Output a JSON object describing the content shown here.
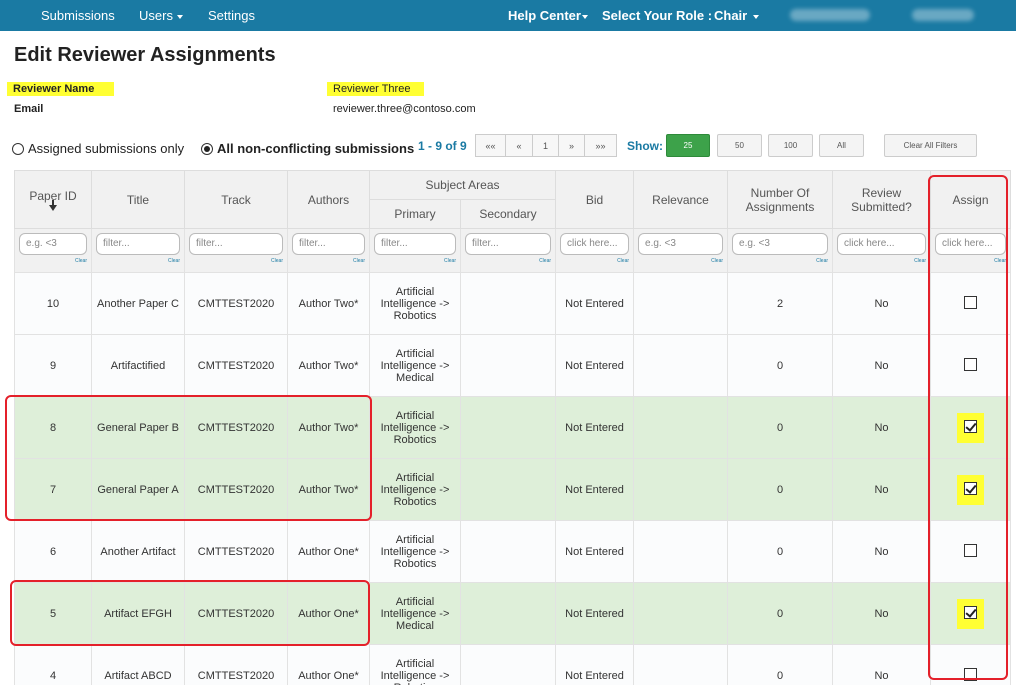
{
  "navbar": {
    "submissions": "Submissions",
    "users": "Users",
    "settings": "Settings",
    "help_center": "Help Center",
    "select_role_label": "Select Your Role :",
    "role": "Chair"
  },
  "page_title": "Edit Reviewer Assignments",
  "reviewer": {
    "name_label": "Reviewer Name",
    "name_value": "Reviewer Three",
    "email_label": "Email",
    "email_value": "reviewer.three@contoso.com"
  },
  "filter_options": {
    "assigned_only": "Assigned submissions only",
    "all_nonconflicting": "All non-conflicting submissions",
    "selected": "all_nonconflicting"
  },
  "pagination": {
    "summary": "1 - 9 of 9",
    "first": "««",
    "prev": "«",
    "current": "1",
    "next": "»",
    "last": "»»"
  },
  "show": {
    "label": "Show:",
    "options": [
      "25",
      "50",
      "100",
      "All"
    ],
    "selected": "25",
    "clear_filters": "Clear All Filters"
  },
  "table": {
    "headers": {
      "paper_id": "Paper ID",
      "title": "Title",
      "track": "Track",
      "authors": "Authors",
      "subject_areas": "Subject Areas",
      "primary": "Primary",
      "secondary": "Secondary",
      "bid": "Bid",
      "relevance": "Relevance",
      "num_assignments": "Number Of Assignments",
      "review_submitted": "Review Submitted?",
      "assign": "Assign"
    },
    "filters": {
      "paper_id": "e.g. <3",
      "title": "filter...",
      "track": "filter...",
      "authors": "filter...",
      "primary": "filter...",
      "secondary": "filter...",
      "bid": "click here...",
      "relevance": "e.g. <3",
      "num_assignments": "e.g. <3",
      "review_submitted": "click here...",
      "assign": "click here...",
      "clear": "Clear"
    },
    "rows": [
      {
        "id": "10",
        "title": "Another Paper C",
        "track": "CMTTEST2020",
        "authors": "Author Two*",
        "primary": "Artificial Intelligence -> Robotics",
        "secondary": "",
        "bid": "Not Entered",
        "relevance": "",
        "assignments": "2",
        "review_submitted": "No",
        "assigned": false
      },
      {
        "id": "9",
        "title": "Artifactified",
        "track": "CMTTEST2020",
        "authors": "Author Two*",
        "primary": "Artificial Intelligence -> Medical",
        "secondary": "",
        "bid": "Not Entered",
        "relevance": "",
        "assignments": "0",
        "review_submitted": "No",
        "assigned": false
      },
      {
        "id": "8",
        "title": "General Paper B",
        "track": "CMTTEST2020",
        "authors": "Author Two*",
        "primary": "Artificial Intelligence -> Robotics",
        "secondary": "",
        "bid": "Not Entered",
        "relevance": "",
        "assignments": "0",
        "review_submitted": "No",
        "assigned": true
      },
      {
        "id": "7",
        "title": "General Paper A",
        "track": "CMTTEST2020",
        "authors": "Author Two*",
        "primary": "Artificial Intelligence -> Robotics",
        "secondary": "",
        "bid": "Not Entered",
        "relevance": "",
        "assignments": "0",
        "review_submitted": "No",
        "assigned": true
      },
      {
        "id": "6",
        "title": "Another Artifact",
        "track": "CMTTEST2020",
        "authors": "Author One*",
        "primary": "Artificial Intelligence -> Robotics",
        "secondary": "",
        "bid": "Not Entered",
        "relevance": "",
        "assignments": "0",
        "review_submitted": "No",
        "assigned": false
      },
      {
        "id": "5",
        "title": "Artifact EFGH",
        "track": "CMTTEST2020",
        "authors": "Author One*",
        "primary": "Artificial Intelligence -> Medical",
        "secondary": "",
        "bid": "Not Entered",
        "relevance": "",
        "assignments": "0",
        "review_submitted": "No",
        "assigned": true
      },
      {
        "id": "4",
        "title": "Artifact ABCD",
        "track": "CMTTEST2020",
        "authors": "Author One*",
        "primary": "Artificial Intelligence -> Robotics",
        "secondary": "",
        "bid": "Not Entered",
        "relevance": "",
        "assignments": "0",
        "review_submitted": "No",
        "assigned": false
      }
    ]
  },
  "colors": {
    "navbar": "#1a7aa3",
    "selected_row": "#deefd9",
    "highlight": "#ffff33",
    "annotation": "#e4202a",
    "active_button": "#3da24a"
  }
}
